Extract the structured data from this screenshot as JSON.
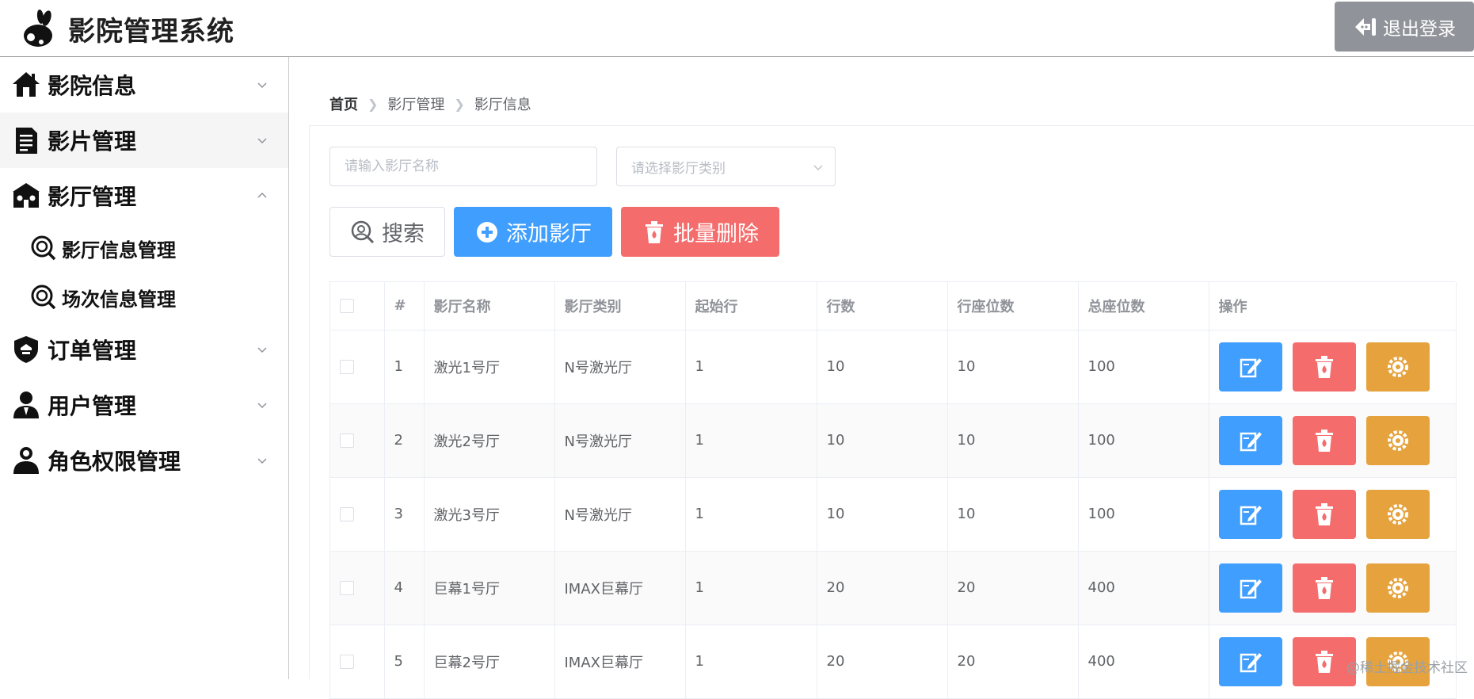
{
  "app": {
    "title": "影院管理系统",
    "logout_label": "退出登录"
  },
  "sidebar": {
    "items": [
      {
        "label": "影院信息",
        "icon": "home-icon",
        "expanded": false
      },
      {
        "label": "影片管理",
        "icon": "document-icon",
        "expanded": false
      },
      {
        "label": "影厅管理",
        "icon": "cinema-hall-icon",
        "expanded": true,
        "children": [
          {
            "label": "影厅信息管理",
            "icon": "search-circle-icon"
          },
          {
            "label": "场次信息管理",
            "icon": "search-circle-icon"
          }
        ]
      },
      {
        "label": "订单管理",
        "icon": "shield-icon",
        "expanded": false
      },
      {
        "label": "用户管理",
        "icon": "user-icon",
        "expanded": false
      },
      {
        "label": "角色权限管理",
        "icon": "user-role-icon",
        "expanded": false
      }
    ]
  },
  "breadcrumb": [
    "首页",
    "影厅管理",
    "影厅信息"
  ],
  "filters": {
    "name_placeholder": "请输入影厅名称",
    "type_placeholder": "请选择影厅类别"
  },
  "toolbar": {
    "search_label": "搜索",
    "add_label": "添加影厅",
    "batch_delete_label": "批量删除"
  },
  "table": {
    "columns": [
      "#",
      "影厅名称",
      "影厅类别",
      "起始行",
      "行数",
      "行座位数",
      "总座位数",
      "操作"
    ],
    "rows": [
      {
        "idx": "1",
        "name": "激光1号厅",
        "type": "N号激光厅",
        "start_row": "1",
        "rows": "10",
        "seats_per_row": "10",
        "total": "100"
      },
      {
        "idx": "2",
        "name": "激光2号厅",
        "type": "N号激光厅",
        "start_row": "1",
        "rows": "10",
        "seats_per_row": "10",
        "total": "100"
      },
      {
        "idx": "3",
        "name": "激光3号厅",
        "type": "N号激光厅",
        "start_row": "1",
        "rows": "10",
        "seats_per_row": "10",
        "total": "100"
      },
      {
        "idx": "4",
        "name": "巨幕1号厅",
        "type": "IMAX巨幕厅",
        "start_row": "1",
        "rows": "20",
        "seats_per_row": "20",
        "total": "400"
      },
      {
        "idx": "5",
        "name": "巨幕2号厅",
        "type": "IMAX巨幕厅",
        "start_row": "1",
        "rows": "20",
        "seats_per_row": "20",
        "total": "400"
      }
    ]
  },
  "watermark": "@稀土掘金技术社区",
  "colors": {
    "primary": "#409eff",
    "danger": "#f56c6c",
    "warning": "#e6a23c",
    "info": "#909399"
  }
}
